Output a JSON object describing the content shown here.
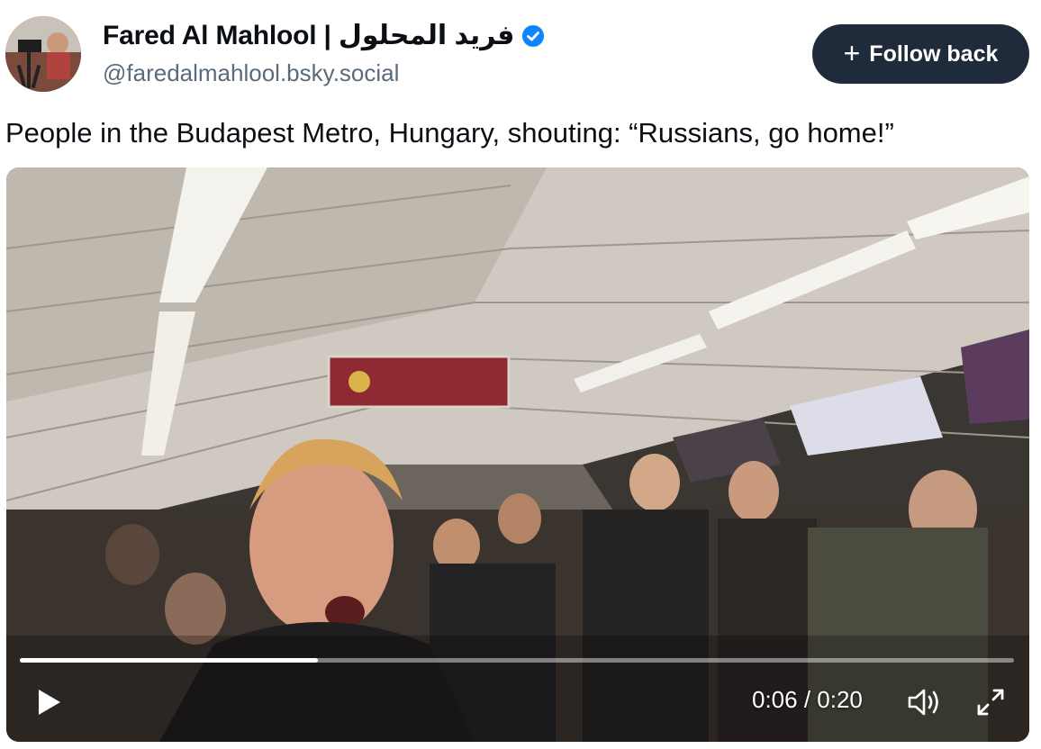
{
  "author": {
    "display_name": "Fared Al Mahlool | فريد المحلول",
    "handle": "@faredalmahlool.bsky.social",
    "avatar_icon": "avatar-photo",
    "verified_icon": "verified-check-icon",
    "verified_color": "#1083fe"
  },
  "follow_button": {
    "icon": "plus-icon",
    "label": "Follow back",
    "background": "#1f2b3b"
  },
  "post": {
    "text": "People in the Budapest Metro, Hungary, shouting: “Russians, go home!”"
  },
  "video": {
    "current_time": "0:06",
    "duration": "0:20",
    "time_display": "0:06 / 0:20",
    "progress_fraction": 0.3,
    "play_icon": "play-icon",
    "mute_icon": "volume-icon",
    "fullscreen_icon": "fullscreen-icon"
  }
}
